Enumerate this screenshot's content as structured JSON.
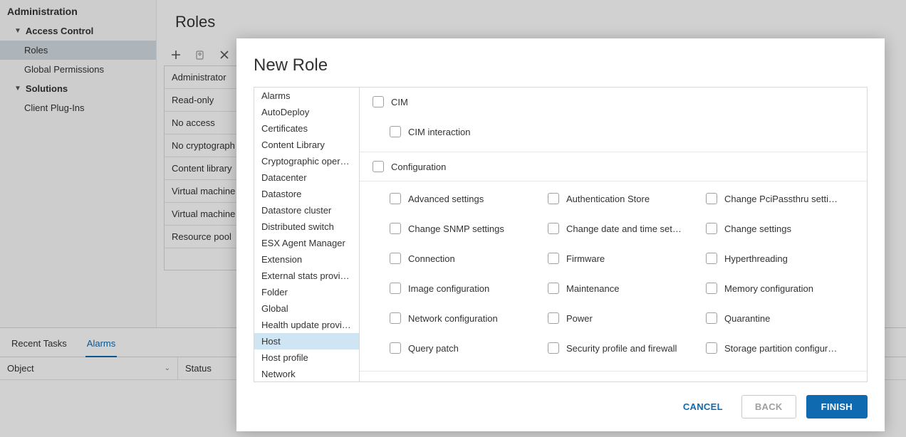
{
  "sidebar": {
    "header": "Administration",
    "groups": [
      {
        "label": "Access Control",
        "items": [
          {
            "label": "Roles",
            "selected": true
          },
          {
            "label": "Global Permissions",
            "selected": false
          }
        ]
      },
      {
        "label": "Solutions",
        "items": [
          {
            "label": "Client Plug-Ins",
            "selected": false
          }
        ]
      }
    ]
  },
  "page": {
    "title": "Roles"
  },
  "toolbar": {
    "add_icon": "plus",
    "clone_icon": "clone",
    "delete_icon": "x"
  },
  "roles_list": [
    "Administrator",
    "Read-only",
    "No access",
    "No cryptograph",
    "Content library",
    "Virtual machine",
    "Virtual machine",
    "Resource pool"
  ],
  "bottom": {
    "tabs": [
      {
        "label": "Recent Tasks",
        "active": false
      },
      {
        "label": "Alarms",
        "active": true
      }
    ],
    "columns": [
      "Object",
      "Status"
    ]
  },
  "modal": {
    "title": "New Role",
    "categories": [
      "Alarms",
      "AutoDeploy",
      "Certificates",
      "Content Library",
      "Cryptographic oper…",
      "Datacenter",
      "Datastore",
      "Datastore cluster",
      "Distributed switch",
      "ESX Agent Manager",
      "Extension",
      "External stats provid…",
      "Folder",
      "Global",
      "Health update provi…",
      "Host",
      "Host profile",
      "Network"
    ],
    "selected_category": "Host",
    "perm_groups": [
      {
        "name": "CIM",
        "items": [
          "CIM interaction"
        ],
        "single": true
      },
      {
        "name": "Configuration",
        "items": [
          "Advanced settings",
          "Authentication Store",
          "Change PciPassthru setti…",
          "Change SNMP settings",
          "Change date and time set…",
          "Change settings",
          "Connection",
          "Firmware",
          "Hyperthreading",
          "Image configuration",
          "Maintenance",
          "Memory configuration",
          "Network configuration",
          "Power",
          "Quarantine",
          "Query patch",
          "Security profile and firewall",
          "Storage partition configur…"
        ],
        "single": false
      }
    ],
    "buttons": {
      "cancel": "CANCEL",
      "back": "BACK",
      "finish": "FINISH"
    }
  }
}
